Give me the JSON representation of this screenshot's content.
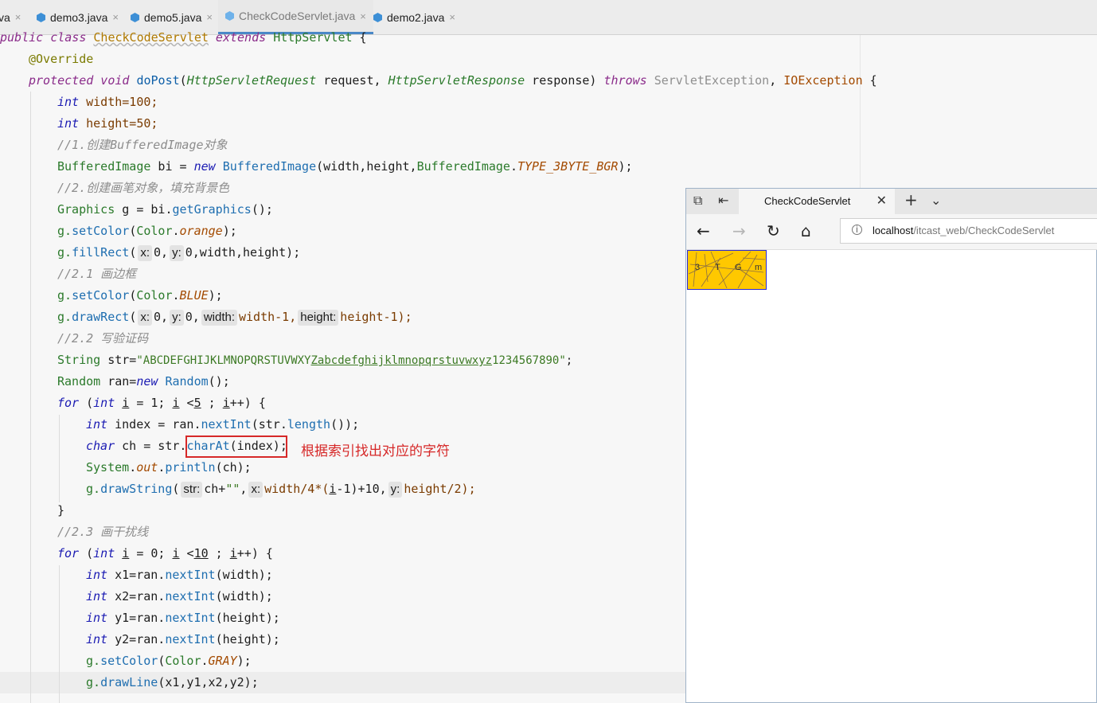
{
  "tabs": [
    {
      "label": "va",
      "icon": "java-class-icon",
      "active": false
    },
    {
      "label": "demo3.java",
      "icon": "java-class-icon",
      "active": false
    },
    {
      "label": "demo5.java",
      "icon": "java-class-icon",
      "active": false
    },
    {
      "label": "CheckCodeServlet.java",
      "icon": "java-class-icon",
      "active": true
    },
    {
      "label": "demo2.java",
      "icon": "java-class-icon",
      "active": false
    }
  ],
  "code": {
    "l1_public_class": "public class ",
    "l1_name": "CheckCodeServlet",
    "l1_extends": " extends ",
    "l1_super": "HttpServlet",
    "l1_brace": " {",
    "l2_ann": "@Override",
    "l3_mods": "protected void ",
    "l3_method": "doPost",
    "l3_p1type": "HttpServletRequest",
    "l3_p1name": " request, ",
    "l3_p2type": "HttpServletResponse",
    "l3_p2name": " response) ",
    "l3_throws": "throws",
    "l3_ex1": "ServletException",
    "l3_comma": ", ",
    "l3_ex2": "IOException",
    "l3_brace": " {",
    "l4_int": "int",
    "l4_rest": " width=100;",
    "l5_int": "int",
    "l5_rest": " height=50;",
    "l6_comment": "//1.创建BufferedImage对象",
    "l7_type": "BufferedImage",
    "l7_a": " bi = ",
    "l7_new": "new",
    "l7_ctor": " BufferedImage",
    "l7_args": "(width,height,",
    "l7_type2": "BufferedImage",
    "l7_dot": ".",
    "l7_const": "TYPE_3BYTE_BGR",
    "l7_end": ");",
    "l8_comment": "//2.创建画笔对象，填充背景色",
    "l9_type": "Graphics",
    "l9_a": " g = bi.",
    "l9_m": "getGraphics",
    "l9_end": "();",
    "l10_g": "g.",
    "l10_m": "setColor",
    "l10_p": "(",
    "l10_cls": "Color",
    "l10_dot": ".",
    "l10_const": "orange",
    "l10_end": ");",
    "l11_g": "g.",
    "l11_m": "fillRect",
    "l11_p": "(",
    "l11_h1": "x:",
    "l11_v1": "0,",
    "l11_h2": "y:",
    "l11_v2": "0,width,height);",
    "l12_comment": "//2.1 画边框",
    "l13_g": "g.",
    "l13_m": "setColor",
    "l13_p": "(",
    "l13_cls": "Color",
    "l13_dot": ".",
    "l13_const": "BLUE",
    "l13_end": ");",
    "l14_g": "g.",
    "l14_m": "drawRect",
    "l14_p": "(",
    "l14_h1": "x:",
    "l14_v1": "0,",
    "l14_h2": "y:",
    "l14_v2": "0,",
    "l14_h3": "width:",
    "l14_v3": "width-1,",
    "l14_h4": "height:",
    "l14_v4": "height-1);",
    "l15_comment": "//2.2 写验证码",
    "l16_type": "String",
    "l16_a": " str=",
    "l16_str1": "\"ABCDEFGHIJKLMNOPQRSTUVWXY",
    "l16_str2": "Zabcdefghijklmnopqrstuvwxyz",
    "l16_str3": "1234567890\"",
    "l16_end": ";",
    "l17_type": "Random",
    "l17_a": " ran=",
    "l17_new": "new",
    "l17_ctor": " Random",
    "l17_end": "();",
    "l18_for": "for",
    "l18_a": " (",
    "l18_int": "int",
    "l18_sp": " ",
    "l18_i1": "i",
    "l18_b": " = 1; ",
    "l18_i2": "i",
    "l18_c": " <",
    "l18_n": "5",
    "l18_d": " ; ",
    "l18_i3": "i",
    "l18_e": "++) {",
    "l19_int": "int",
    "l19_a": " index = ran.",
    "l19_m": "nextInt",
    "l19_b": "(str.",
    "l19_m2": "length",
    "l19_end": "());",
    "l20_char": "char",
    "l20_a": " ch = str.",
    "l20_m": "charAt",
    "l20_end": "(index);",
    "l21_cls": "System",
    "l21_dot": ".",
    "l21_fld": "out",
    "l21_dot2": ".",
    "l21_m": "println",
    "l21_end": "(ch);",
    "l22_g": "g.",
    "l22_m": "drawString",
    "l22_p": "(",
    "l22_h1": "str:",
    "l22_v1": "ch+",
    "l22_s": "\"\"",
    "l22_c": ",",
    "l22_h2": "x:",
    "l22_v2": "width/4*(",
    "l22_i": "i",
    "l22_v2b": "-1)+10,",
    "l22_h3": "y:",
    "l22_v3": "height/2);",
    "l23": "}",
    "l24_comment": "//2.3 画干扰线",
    "l25_for": "for",
    "l25_a": " (",
    "l25_int": "int",
    "l25_sp": " ",
    "l25_i1": "i",
    "l25_b": " = 0; ",
    "l25_i2": "i",
    "l25_c": " <",
    "l25_n": "10",
    "l25_d": " ; ",
    "l25_i3": "i",
    "l25_e": "++) {",
    "l26_int": "int",
    "l26_a": " x1=ran.",
    "l26_m": "nextInt",
    "l26_end": "(width);",
    "l27_int": "int",
    "l27_a": " x2=ran.",
    "l27_m": "nextInt",
    "l27_end": "(width);",
    "l28_int": "int",
    "l28_a": " y1=ran.",
    "l28_m": "nextInt",
    "l28_end": "(height);",
    "l29_int": "int",
    "l29_a": " y2=ran.",
    "l29_m": "nextInt",
    "l29_end": "(height);",
    "l30_g": "g.",
    "l30_m": "setColor",
    "l30_p": "(",
    "l30_cls": "Color",
    "l30_dot": ".",
    "l30_const": "GRAY",
    "l30_end": ");",
    "l31_g": "g.",
    "l31_m": "drawLine",
    "l31_end": "(x1,y1,x2,y2);"
  },
  "annotation": "根据索引找出对应的字符",
  "browser": {
    "tab_title": "CheckCodeServlet",
    "url_host": "localhost",
    "url_path": "/itcast_web/CheckCodeServlet",
    "captcha_chars": [
      "3",
      "T",
      "G",
      "m"
    ]
  },
  "colors": {
    "accent_tab": "#4a88c7",
    "annotation_red": "#d62828",
    "captcha_bg": "#ffc800",
    "captcha_border": "#2a2ad6"
  }
}
